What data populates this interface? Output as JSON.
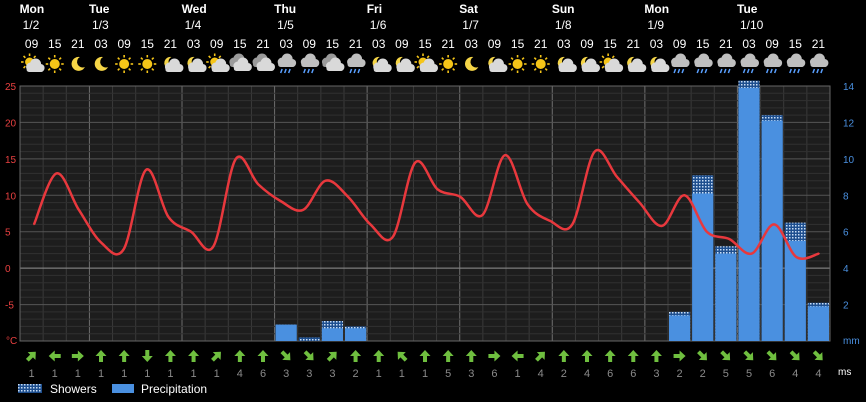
{
  "chart_data": {
    "type": "bar+line",
    "days": [
      {
        "name": "Mon",
        "date": "1/2"
      },
      {
        "name": "Tue",
        "date": "1/3"
      },
      {
        "name": "Wed",
        "date": "1/4"
      },
      {
        "name": "Thu",
        "date": "1/5"
      },
      {
        "name": "Fri",
        "date": "1/6"
      },
      {
        "name": "Sat",
        "date": "1/7"
      },
      {
        "name": "Sun",
        "date": "1/8"
      },
      {
        "name": "Mon",
        "date": "1/9"
      },
      {
        "name": "Tue",
        "date": "1/10"
      }
    ],
    "hours": [
      "09",
      "15",
      "21",
      "03",
      "09",
      "15",
      "21",
      "03",
      "09",
      "15",
      "21",
      "03",
      "09",
      "15",
      "21",
      "03",
      "09",
      "15",
      "21",
      "03",
      "09",
      "15",
      "21",
      "03",
      "09",
      "15",
      "21",
      "03",
      "09",
      "15",
      "21",
      "03",
      "09",
      "15",
      "21"
    ],
    "day_start_index": [
      0,
      3,
      7,
      11,
      15,
      19,
      23,
      27,
      31
    ],
    "weather_icons": [
      "partly-sunny",
      "sun",
      "moon",
      "moon",
      "sun",
      "sun",
      "moon-cloud",
      "moon-cloud",
      "sun-cloud",
      "cloudy",
      "cloudy",
      "rain-cloud",
      "rain-cloud",
      "cloudy",
      "rain-cloud",
      "moon-cloud",
      "moon-cloud",
      "sun-cloud",
      "sun",
      "moon",
      "moon-cloud",
      "sun",
      "sun",
      "moon-cloud",
      "moon-cloud",
      "sun-cloud",
      "moon-cloud",
      "moon-cloud",
      "rain-cloud",
      "rain-cloud",
      "rain-cloud",
      "rain-cloud",
      "rain-cloud",
      "rain-cloud",
      "rain-cloud"
    ],
    "temperature": {
      "unit": "°C",
      "ylim": [
        -10,
        25
      ],
      "ticks": [
        25,
        20,
        15,
        10,
        5,
        0,
        -5
      ],
      "color": "#e8383d",
      "values": [
        6,
        13,
        8,
        3.5,
        2.6,
        13.5,
        7,
        5,
        3,
        15,
        11.5,
        9.2,
        8,
        12,
        9.8,
        6,
        4.3,
        14.5,
        10.8,
        9.8,
        7.3,
        15.5,
        8.8,
        6.5,
        6,
        16,
        12.5,
        9,
        5.8,
        10,
        5,
        4,
        2,
        6,
        1.5,
        2
      ]
    },
    "precipitation": {
      "unit": "mm",
      "ylim": [
        0,
        14
      ],
      "ticks": [
        14,
        12,
        10,
        8,
        6,
        4,
        2
      ],
      "color": "#4a90e0",
      "bars": [
        {
          "i": 11,
          "precip": 0.9,
          "showers": 0.9
        },
        {
          "i": 12,
          "precip": 0,
          "showers": 0.2
        },
        {
          "i": 13,
          "precip": 0.7,
          "showers": 1.1
        },
        {
          "i": 14,
          "precip": 0.7,
          "showers": 0.8
        },
        {
          "i": 28,
          "precip": 1.4,
          "showers": 1.6
        },
        {
          "i": 29,
          "precip": 8.1,
          "showers": 9.1
        },
        {
          "i": 30,
          "precip": 4.8,
          "showers": 5.2
        },
        {
          "i": 31,
          "precip": 13.9,
          "showers": 14.3
        },
        {
          "i": 32,
          "precip": 12.1,
          "showers": 12.4
        },
        {
          "i": 33,
          "precip": 5.5,
          "showers": 6.5
        },
        {
          "i": 34,
          "precip": 1.9,
          "showers": 2.1
        }
      ]
    },
    "wind": {
      "unit": "ms",
      "arrow_color": "#6fbf3f",
      "speeds": [
        1,
        1,
        1,
        1,
        1,
        1,
        1,
        1,
        1,
        4,
        6,
        3,
        3,
        3,
        2,
        1,
        1,
        1,
        5,
        3,
        6,
        1,
        4,
        2,
        4,
        6,
        6,
        3,
        2,
        2,
        5,
        5,
        6,
        4,
        4
      ],
      "directions": [
        45,
        270,
        90,
        0,
        0,
        180,
        0,
        0,
        45,
        0,
        0,
        135,
        135,
        45,
        0,
        0,
        315,
        0,
        0,
        0,
        90,
        270,
        45,
        0,
        0,
        0,
        0,
        0,
        90,
        135,
        135,
        135,
        135,
        135,
        135
      ]
    },
    "legend": [
      {
        "label": "Showers",
        "pattern": "showers"
      },
      {
        "label": "Precipitation",
        "color": "#4a90e0"
      }
    ]
  }
}
